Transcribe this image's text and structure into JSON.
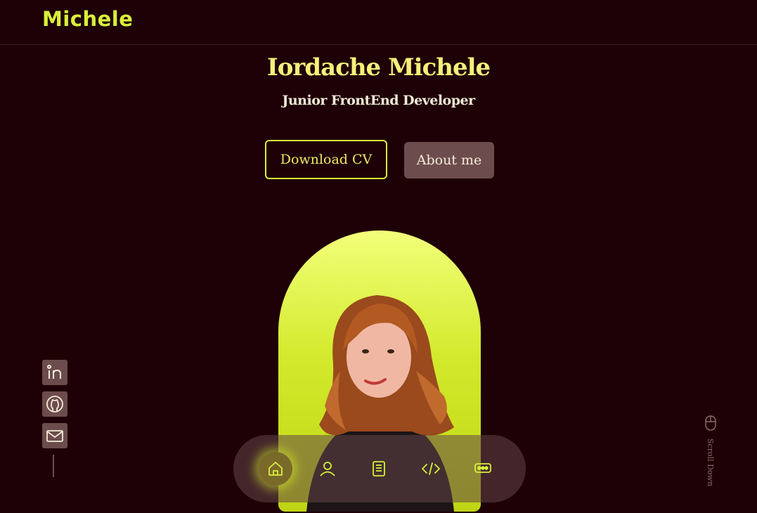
{
  "header": {
    "logo": "Michele"
  },
  "hero": {
    "name": "Iordache Michele",
    "role": "Junior FrontEnd Developer",
    "download_cv_label": "Download CV",
    "about_label": "About me"
  },
  "socials": [
    {
      "icon": "linkedin-icon"
    },
    {
      "icon": "github-icon"
    },
    {
      "icon": "mail-icon"
    }
  ],
  "scroll": {
    "label": "Scroll Down"
  },
  "nav": {
    "items": [
      {
        "icon": "home-icon",
        "active": true
      },
      {
        "icon": "user-icon",
        "active": false
      },
      {
        "icon": "book-icon",
        "active": false
      },
      {
        "icon": "code-icon",
        "active": false
      },
      {
        "icon": "chat-icon",
        "active": false
      }
    ]
  },
  "colors": {
    "background": "#1e0106",
    "accent": "#d8f03a",
    "muted_button": "#6d4c4e"
  }
}
